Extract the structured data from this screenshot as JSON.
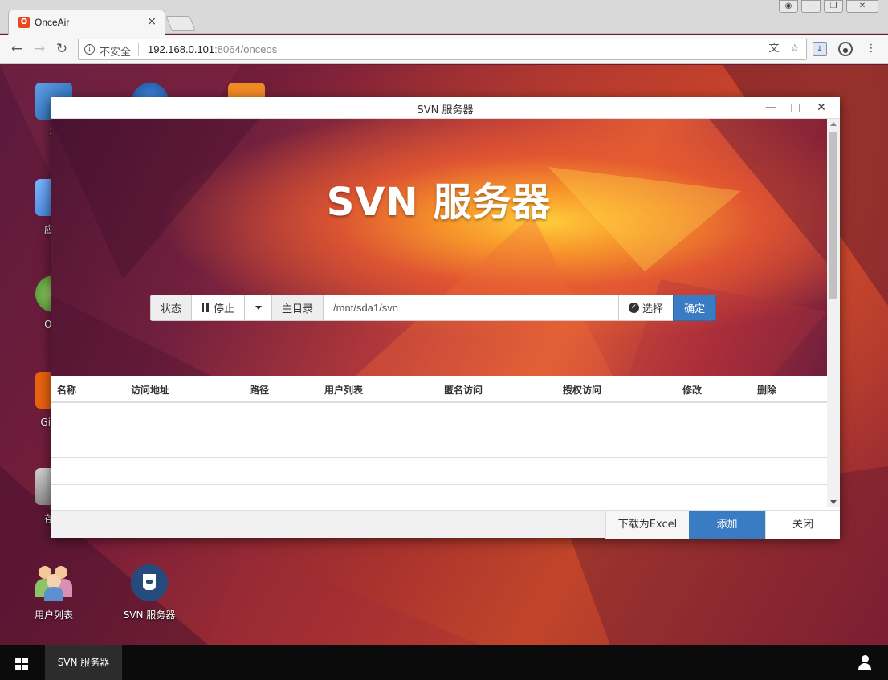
{
  "browser": {
    "tab_title": "OnceAir",
    "tab_close": "×",
    "insecure_label": "不安全",
    "url_host": "192.168.0.101",
    "url_rest": ":8064/onceos"
  },
  "desktop_icons": [
    {
      "label": "系"
    },
    {
      "label": "应用"
    },
    {
      "label": "Onc"
    },
    {
      "label": "Git 月"
    },
    {
      "label": "存储"
    },
    {
      "label": "用户列表"
    },
    {
      "label": "SVN 服务器"
    }
  ],
  "dialog": {
    "title": "SVN 服务器",
    "hero_title": "SVN 服务器",
    "controls": {
      "status_label": "状态",
      "stop_label": "停止",
      "home_dir_label": "主目录",
      "home_dir_value": "/mnt/sda1/svn",
      "choose_label": "选择",
      "confirm_label": "确定"
    },
    "table": {
      "columns": [
        "名称",
        "访问地址",
        "路径",
        "用户列表",
        "匿名访问",
        "授权访问",
        "修改",
        "删除"
      ],
      "rows": []
    },
    "footer": {
      "excel_label": "下载为Excel",
      "add_label": "添加",
      "close_label": "关闭"
    }
  },
  "taskbar": {
    "active_item": "SVN 服务器"
  },
  "colors": {
    "primary": "#3a7cc4",
    "taskbar": "#0b0b0b"
  }
}
